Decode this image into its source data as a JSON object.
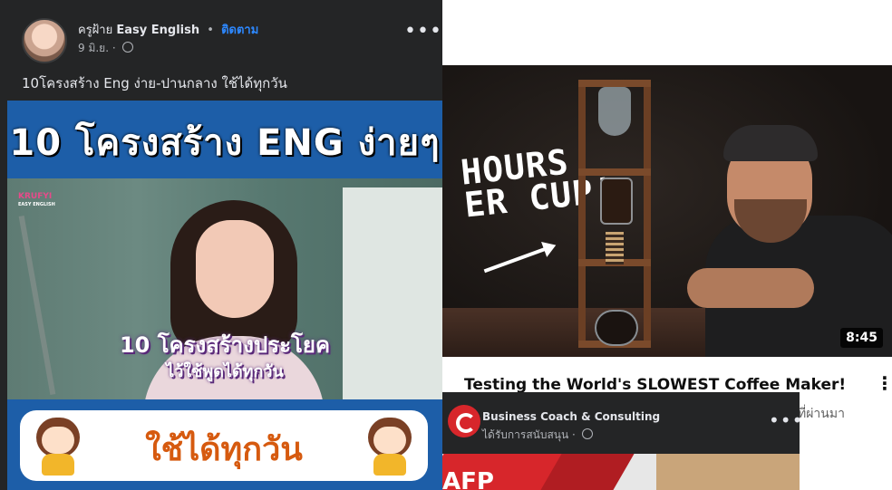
{
  "fb_post": {
    "author": "ครูฝ้าย",
    "page_name": "Easy English",
    "dot": "•",
    "follow_label": "ติดตาม",
    "date": "9 มิ.ย.",
    "meta_dot": "·",
    "more_label": "•••",
    "caption": "10โครงสร้าง Eng ง่าย-ปานกลาง ใช้ได้ทุกวัน",
    "image": {
      "header_title": "10 โครงสร้าง ENG ง่ายๆ",
      "brand": "KRUFYI",
      "brand_sub": "EASY ENGLISH",
      "overlay_line1": "10 โครงสร้างประโยค",
      "overlay_line2": "ไว้ใช้พูดได้ทุกวัน",
      "slogan": "ใช้ได้ทุกวัน"
    }
  },
  "youtube": {
    "thumbnail_text": "HOURS\nER CUP!",
    "duration": "8:45",
    "title": "Testing the World's SLOWEST Coffee Maker!",
    "subline": "ที่ผ่านมา",
    "menu_label": "⋮"
  },
  "sponsored": {
    "page_name": "Business Coach & Consulting",
    "meta": "ได้รับการสนับสนุน ·",
    "more_label": "•••",
    "banner_text": "AFP"
  },
  "colors": {
    "fb_dark": "#242526",
    "fb_link": "#2d88ff",
    "banner_blue": "#1d5ea8",
    "slogan_orange": "#d65a0f",
    "brand_red": "#d7262b"
  }
}
